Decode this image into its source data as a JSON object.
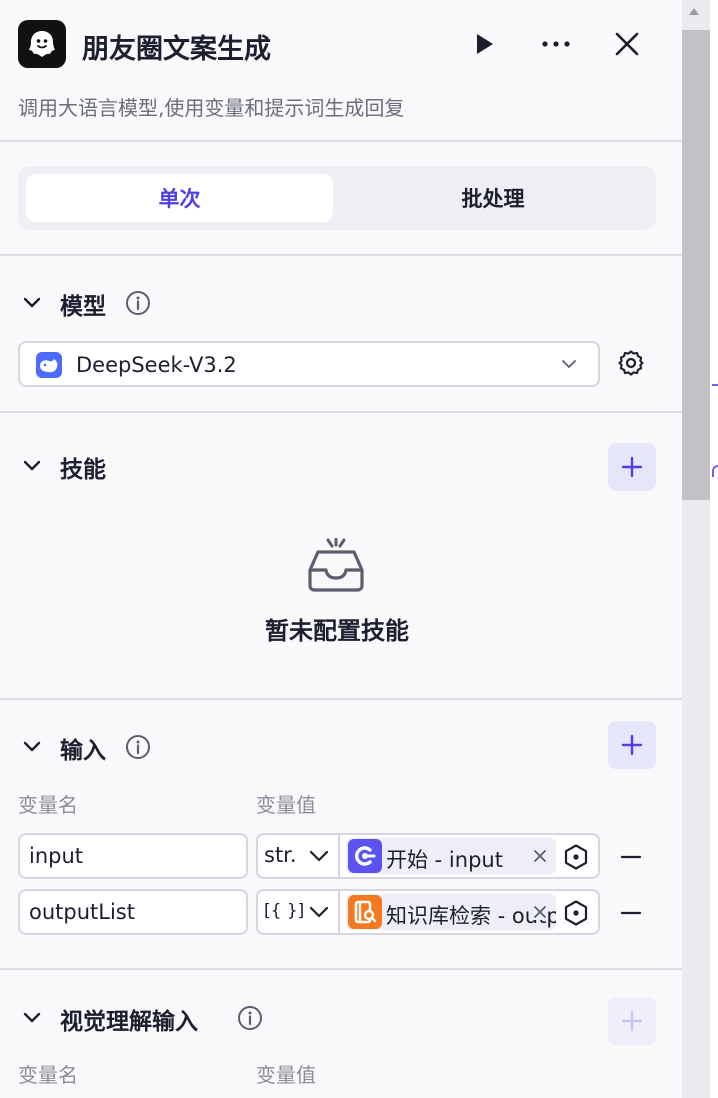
{
  "header": {
    "title": "朋友圈文案生成",
    "description": "调用大语言模型,使用变量和提示词生成回复"
  },
  "tabs": [
    {
      "label": "单次",
      "active": true
    },
    {
      "label": "批处理",
      "active": false
    }
  ],
  "model_section": {
    "title": "模型",
    "selected_model": "DeepSeek-V3.2"
  },
  "skills_section": {
    "title": "技能",
    "empty_text": "暂未配置技能"
  },
  "input_section": {
    "title": "输入",
    "col_name": "变量名",
    "col_value": "变量值",
    "rows": [
      {
        "name": "input",
        "type": "str.",
        "ref": "开始 - input",
        "ref_color": "#5b53f0"
      },
      {
        "name": "outputList",
        "type": "[{ }]",
        "ref": "知识库检索 - output",
        "ref_color": "#f37a1f"
      }
    ]
  },
  "vision_section": {
    "title": "视觉理解输入",
    "col_name": "变量名",
    "col_value": "变量值"
  },
  "colors": {
    "accent": "#4e40e5",
    "add_button_bg": "#e6e6fb",
    "divider": "#dcdde5"
  }
}
